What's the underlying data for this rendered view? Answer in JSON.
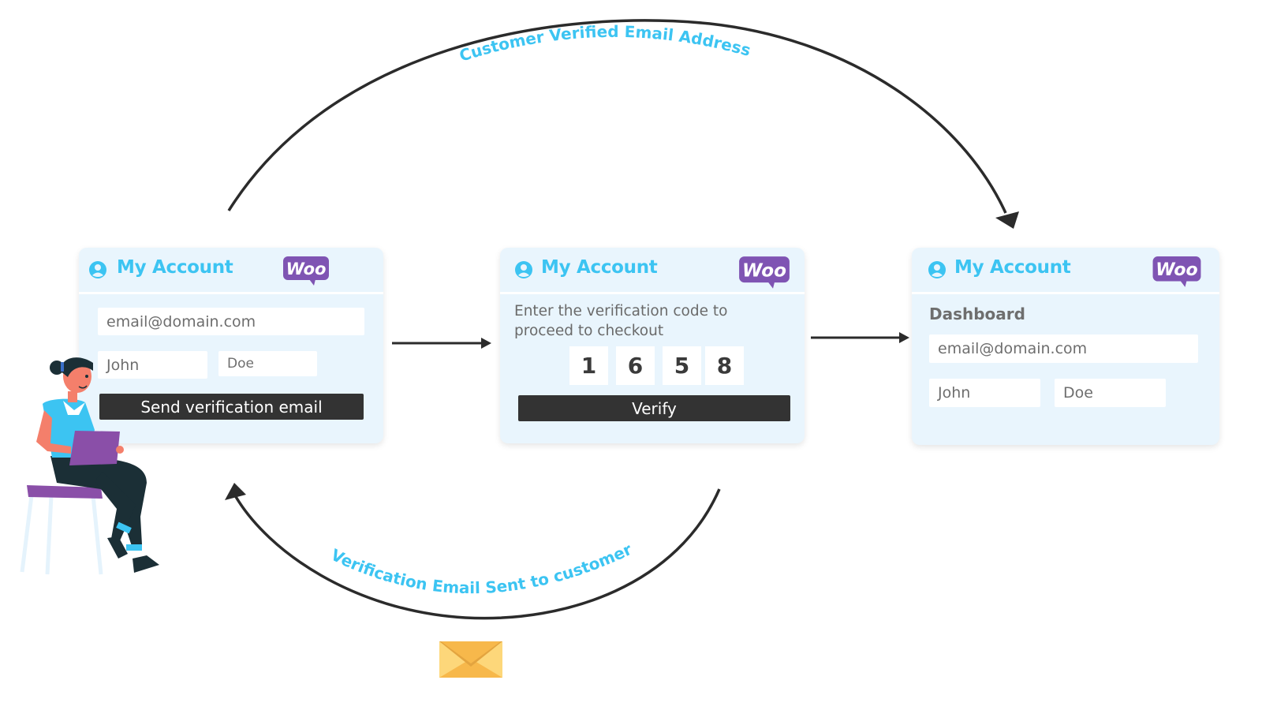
{
  "diagram": {
    "flow_labels": {
      "top_arc": "Customer Verified Email Address",
      "bottom_arc": "Verification Email Sent to customer"
    },
    "colors": {
      "accent": "#3cc4f2",
      "woo_purple": "#7f54b3",
      "card_bg": "#e9f5fd",
      "button_bg": "#333333",
      "arrow": "#2b2b2b",
      "envelope": "#f7b84b"
    },
    "icons": {
      "account": "user-circle-icon",
      "brand": "woo-logo",
      "mail": "envelope-icon"
    }
  },
  "cards": [
    {
      "title": "My Account",
      "brand": "Woo",
      "email": "email@domain.com",
      "first_name": "John",
      "last_name": "Doe",
      "button": "Send verification email"
    },
    {
      "title": "My Account",
      "brand": "Woo",
      "description_line1": "Enter the verification code to",
      "description_line2": "proceed to checkout",
      "code": [
        "1",
        "6",
        "5",
        "8"
      ],
      "button": "Verify"
    },
    {
      "title": "My Account",
      "brand": "Woo",
      "section": "Dashboard",
      "email": "email@domain.com",
      "first_name": "John",
      "last_name": "Doe"
    }
  ]
}
